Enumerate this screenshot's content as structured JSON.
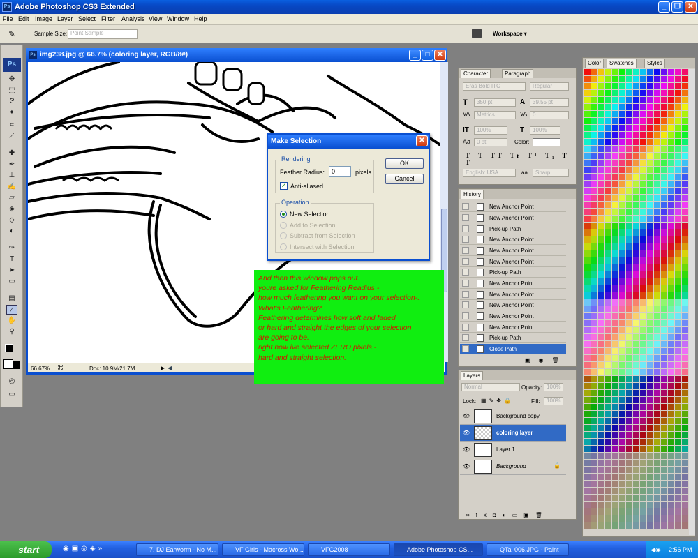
{
  "app": {
    "title": "Adobe Photoshop CS3 Extended",
    "icon": "Ps"
  },
  "menu": [
    "File",
    "Edit",
    "Image",
    "Layer",
    "Select",
    "Filter",
    "Analysis",
    "View",
    "Window",
    "Help"
  ],
  "options": {
    "sample_size_label": "Sample Size:",
    "sample_size_value": "Point Sample",
    "workspace": "Workspace ▾"
  },
  "document": {
    "title": "img238.jpg @ 66.7% (coloring layer, RGB/8#)",
    "zoom": "66.67%",
    "doc_info": "Doc: 10.9M/21.7M"
  },
  "dialog": {
    "title": "Make Selection",
    "rendering_label": "Rendering",
    "feather_label": "Feather Radius:",
    "feather_value": "0",
    "feather_unit": "pixels",
    "anti_aliased": "Anti-aliased",
    "operation_label": "Operation",
    "ops": [
      "New Selection",
      "Add to Selection",
      "Subtract from Selection",
      "Intersect with Selection"
    ],
    "ok": "OK",
    "cancel": "Cancel"
  },
  "note": {
    "lines": [
      "And then this window pops out.",
      "youre asked for  Feathering Readius -",
      "how much feathering you want on your selection-.",
      "What's Feathering?",
      "Feathering determines how soft and faded",
      "or hard and straight the edges of your selection",
      "are going to be.",
      "right now ive selected ZERO pixels -",
      "hard and straight selection."
    ]
  },
  "character": {
    "tabs": [
      "Character",
      "Paragraph"
    ],
    "font": "Eras Bold ITC",
    "style": "Regular",
    "size": "350 pt",
    "leading": "39.55 pt",
    "kerning": "Metrics",
    "tracking": "0",
    "vscale": "100%",
    "hscale": "100%",
    "baseline": "0 pt",
    "color_label": "Color:",
    "lang": "English: USA",
    "aa": "Sharp"
  },
  "history": {
    "tab": "History",
    "items": [
      "New Anchor Point",
      "New Anchor Point",
      "Pick-up Path",
      "New Anchor Point",
      "New Anchor Point",
      "New Anchor Point",
      "Pick-up Path",
      "New Anchor Point",
      "New Anchor Point",
      "New Anchor Point",
      "New Anchor Point",
      "New Anchor Point",
      "Pick-up Path",
      "Close Path"
    ]
  },
  "layers": {
    "tab": "Layers",
    "blend": "Normal",
    "opacity_label": "Opacity:",
    "opacity": "100%",
    "lock_label": "Lock:",
    "fill_label": "Fill:",
    "fill": "100%",
    "items": [
      "Background copy",
      "coloring layer",
      "Layer 1",
      "Background"
    ]
  },
  "swatches": {
    "tabs": [
      "Color",
      "Swatches",
      "Styles"
    ]
  },
  "taskbar": {
    "start": "start",
    "tasks": [
      "7. DJ Earworm - No M...",
      "VF Girls - Macross Wo...",
      "VFG2008",
      "Adobe Photoshop CS...",
      "QTai 006.JPG - Paint"
    ],
    "time": "2:56 PM"
  }
}
